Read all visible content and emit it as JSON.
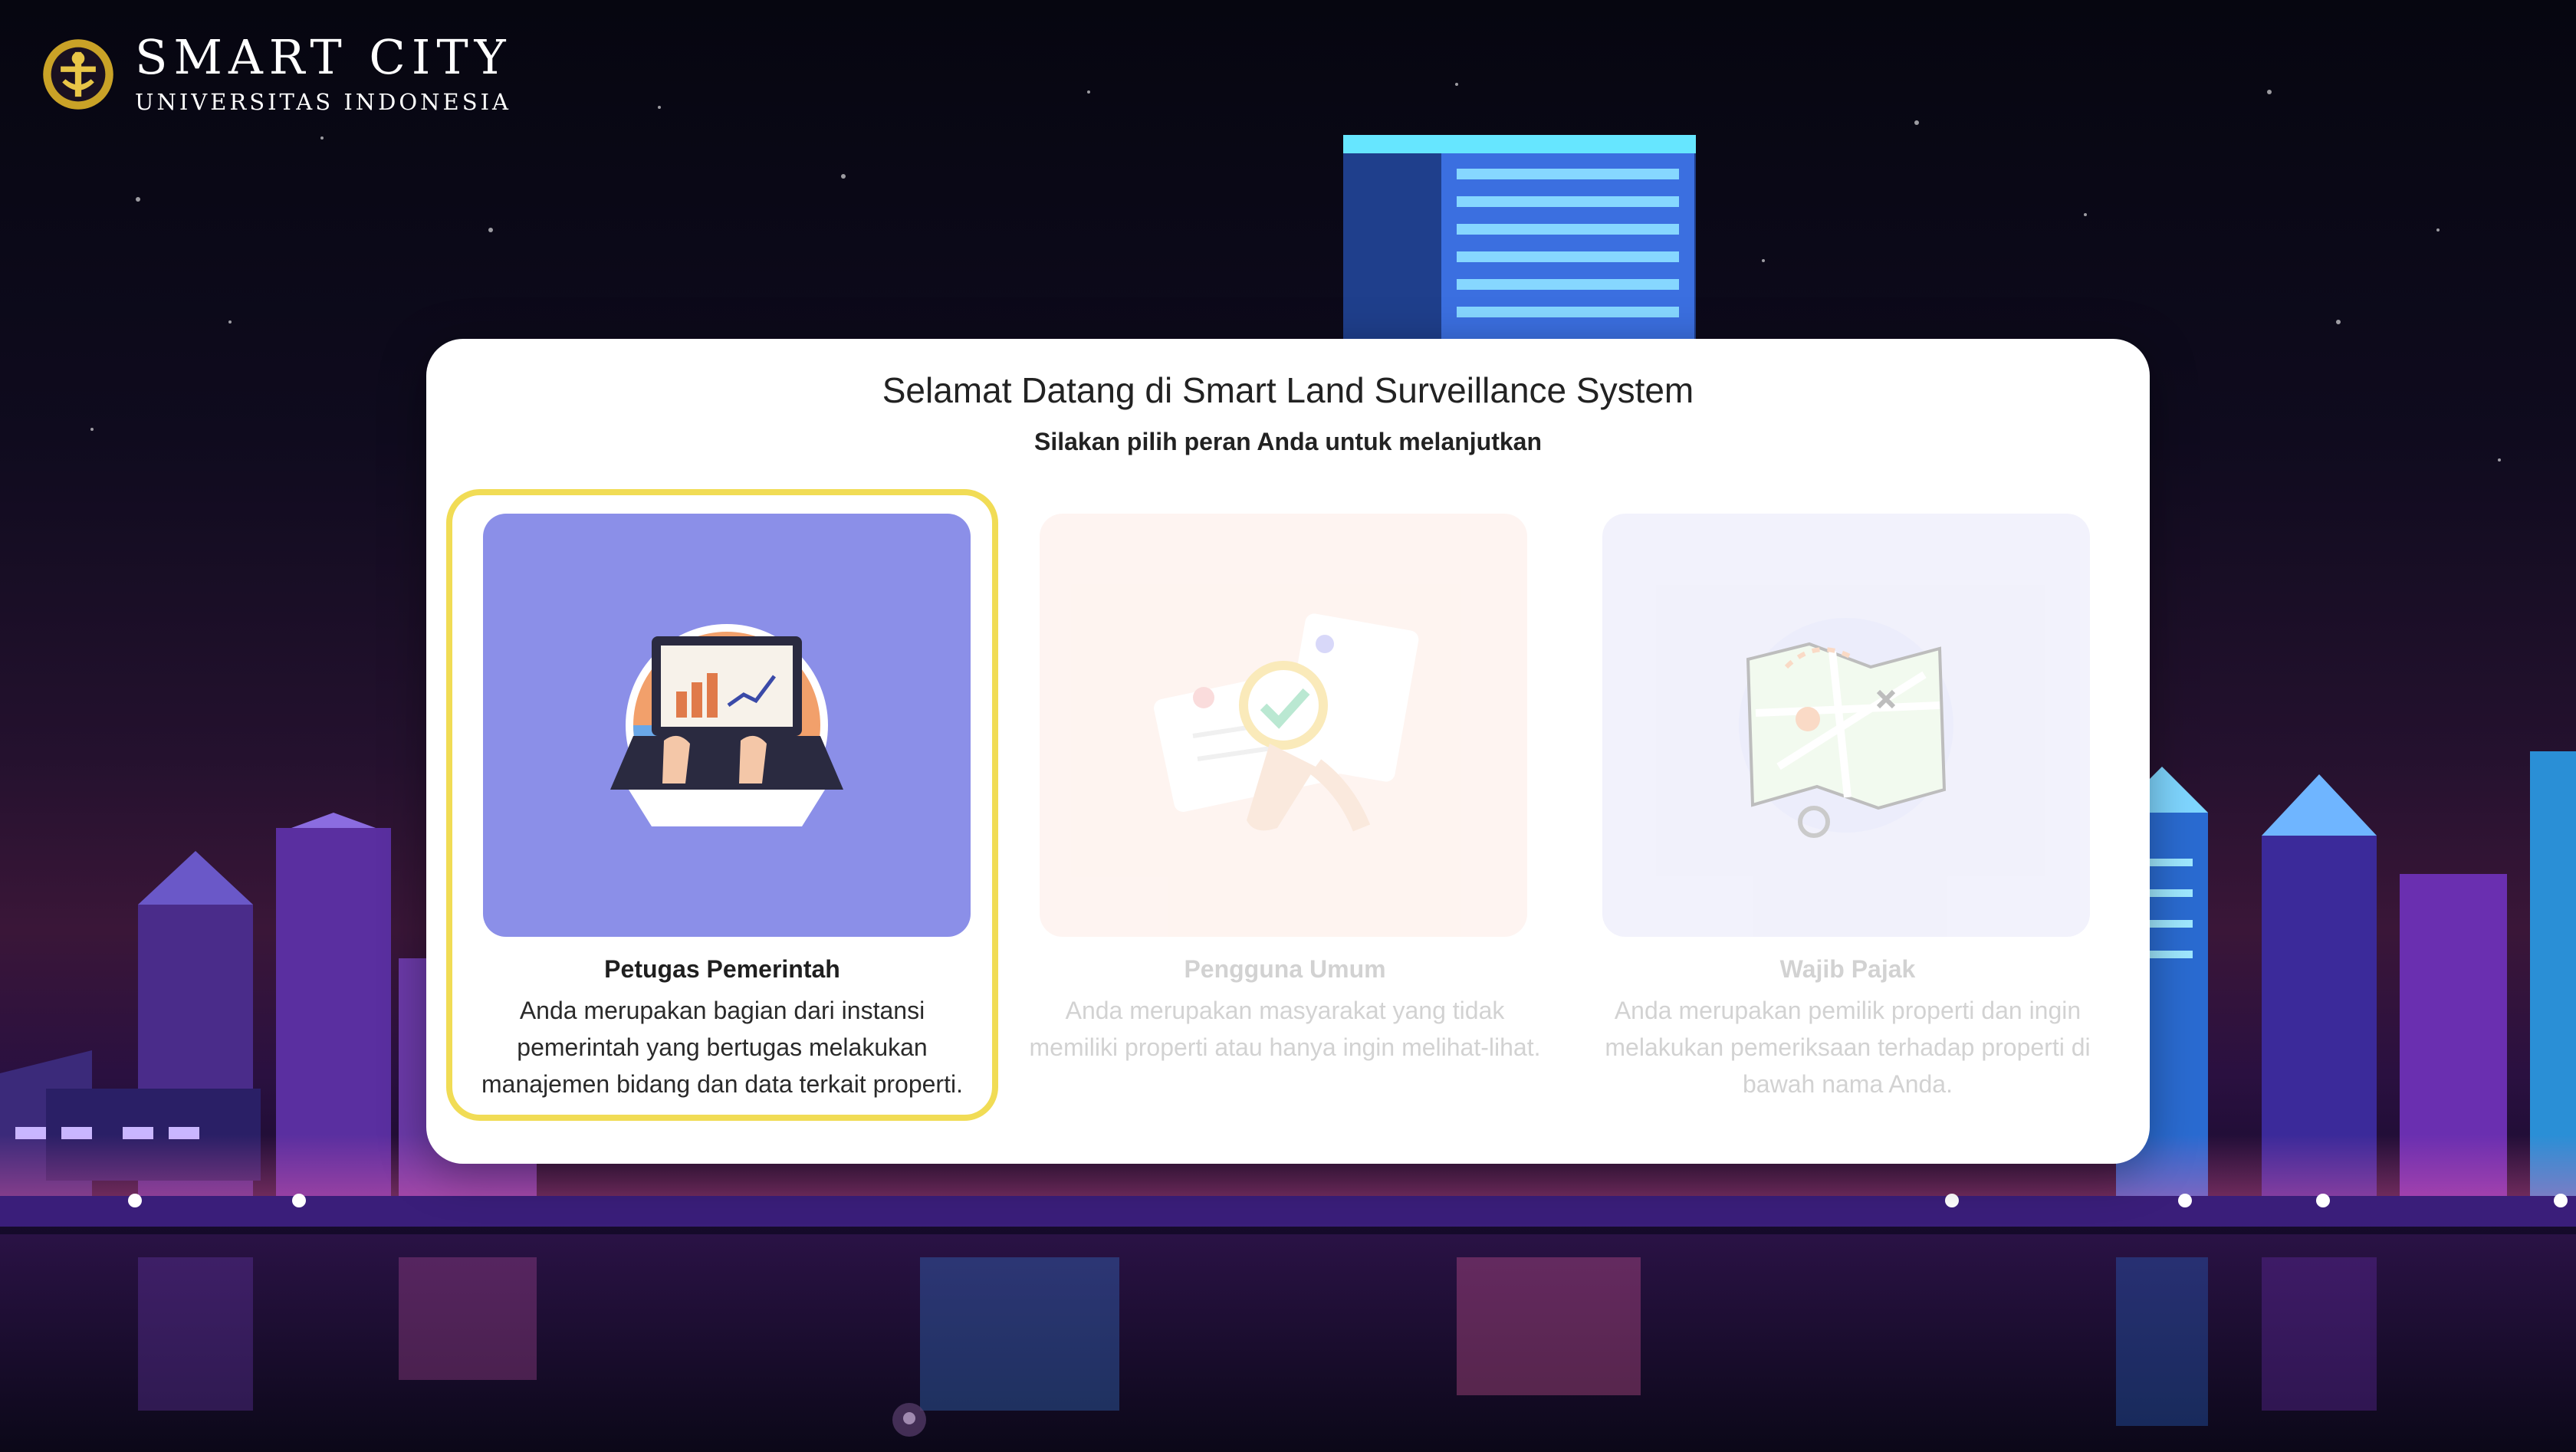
{
  "brand": {
    "title": "SMART CITY",
    "subtitle": "UNIVERSITAS INDONESIA"
  },
  "dialog": {
    "title": "Selamat Datang di Smart Land Surveillance System",
    "subtitle": "Silakan pilih peran Anda untuk melanjutkan"
  },
  "roles": [
    {
      "name": "Petugas Pemerintah",
      "description": "Anda merupakan bagian dari instansi pemerintah yang bertugas melakukan manajemen bidang dan data terkait properti.",
      "selected": true,
      "card_color": "#8b8fe8",
      "icon": "laptop-analytics-illustration"
    },
    {
      "name": "Pengguna Umum",
      "description": "Anda merupakan masyarakat yang tidak memiliki properti atau hanya ingin melihat-lihat.",
      "selected": false,
      "card_color": "#fde3d9",
      "icon": "document-inspection-illustration"
    },
    {
      "name": "Wajib Pajak",
      "description": "Anda merupakan pemilik properti dan ingin melakukan pemeriksaan terhadap properti di bawah nama Anda.",
      "selected": false,
      "card_color": "#dcdcf6",
      "icon": "map-illustration"
    }
  ],
  "colors": {
    "selection_border": "#f1dc55",
    "dialog_background": "#ffffff"
  }
}
